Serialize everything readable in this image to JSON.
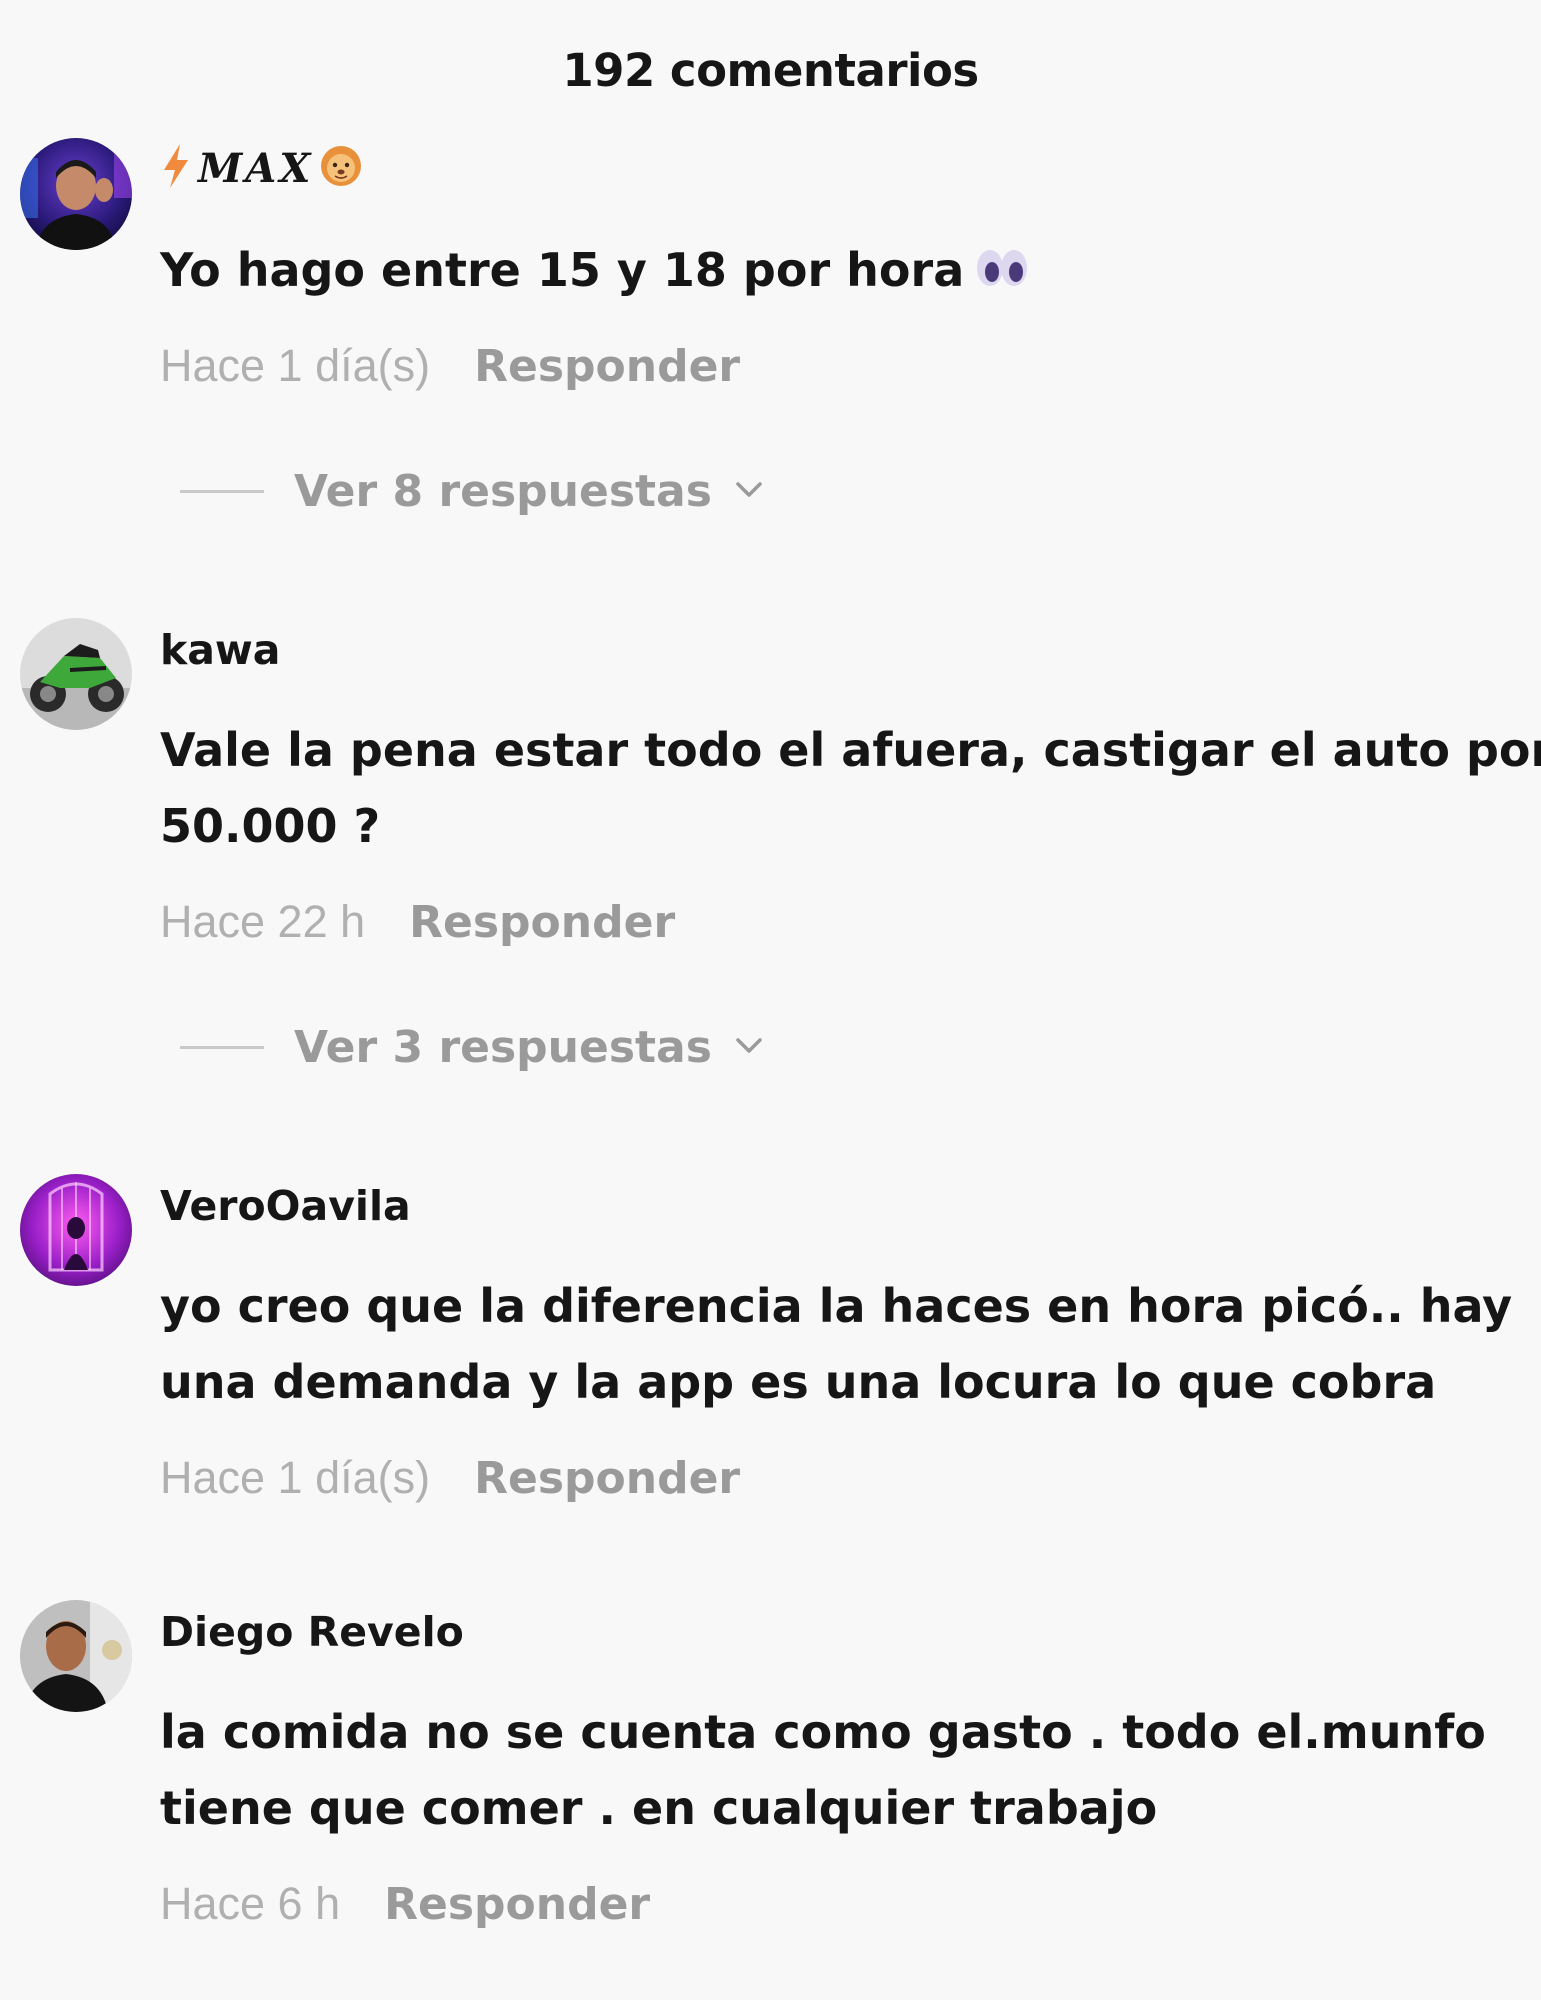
{
  "header": {
    "title": "192 comentarios"
  },
  "comments": [
    {
      "username": "MAX",
      "text_lines": [
        "Yo hago entre 15 y 18 por hora"
      ],
      "time": "Hace 1 día(s)",
      "reply_label": "Responder",
      "view_replies": "Ver 8 respuestas",
      "emoji": "eyes-emoji"
    },
    {
      "username": "kawa",
      "text_lines": [
        "Vale la pena estar todo el afuera, castigar el auto por",
        "50.000 ?"
      ],
      "time": "Hace 22 h",
      "reply_label": "Responder",
      "view_replies": "Ver 3 respuestas"
    },
    {
      "username": "VeroOavila",
      "text_lines": [
        "yo creo que la diferencia la haces en hora picó.. hay",
        "una demanda y la app es una locura lo que cobra"
      ],
      "time": "Hace 1 día(s)",
      "reply_label": "Responder"
    },
    {
      "username": "Diego Revelo",
      "text_lines": [
        "la comida no se cuenta como gasto . todo el.munfo",
        "tiene que comer . en cualquier trabajo"
      ],
      "time": "Hace 6 h",
      "reply_label": "Responder"
    }
  ],
  "icons": {
    "lightning": "lightning-icon",
    "lion": "lion-face-emoji",
    "eyes": "eyes-emoji",
    "chevron": "chevron-down-icon"
  },
  "colors": {
    "background": "#f8f8f8",
    "text": "#161616",
    "muted": "#9a9a9a",
    "time": "#b0b0b0",
    "lightning": "#f08a3c"
  }
}
